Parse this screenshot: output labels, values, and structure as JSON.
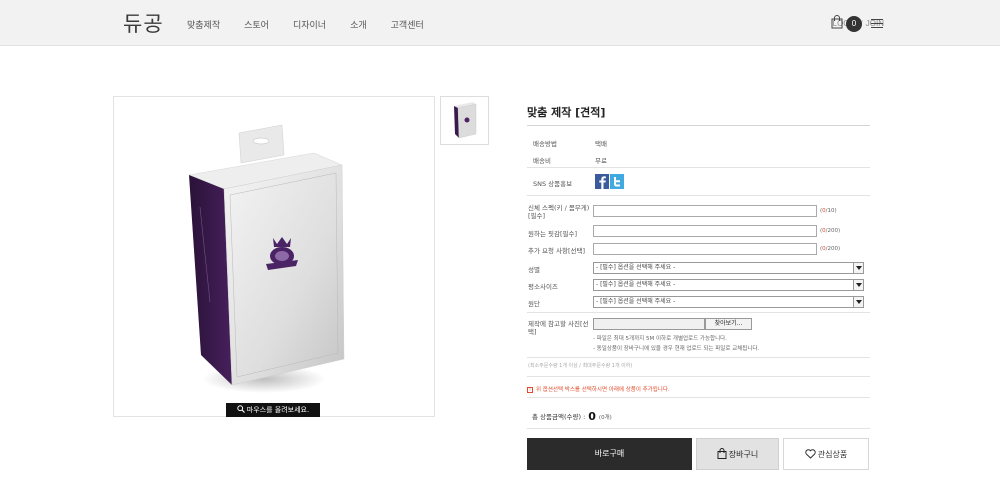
{
  "header": {
    "logo": "듀공",
    "nav": [
      "맞춤제작",
      "스토어",
      "디자이너",
      "소개",
      "고객센터"
    ],
    "login": "LOGIN",
    "join": "JOIN",
    "cart_count": "0"
  },
  "gallery": {
    "zoom_hint": "마우스를 올려보세요."
  },
  "product": {
    "title": "맞춤 제작 [견적]",
    "info": [
      {
        "label": "배송방법",
        "value": "택배"
      },
      {
        "label": "배송비",
        "value": "무료"
      }
    ],
    "sns_label": "SNS 상품홍보",
    "inputs": [
      {
        "label": "신체 스펙(키 / 몸무게)[필수]",
        "count_cur": "0",
        "count_max": "/10)"
      },
      {
        "label": "원하는 핏감[필수]",
        "count_cur": "0",
        "count_max": "/200)"
      },
      {
        "label": "추가 요청 사항[선택]",
        "count_cur": "0",
        "count_max": "/200)"
      }
    ],
    "selects": [
      {
        "label": "성별",
        "value": "- [필수] 옵션을 선택해 주세요 -"
      },
      {
        "label": "평소사이즈",
        "value": "- [필수] 옵션을 선택해 주세요 -"
      },
      {
        "label": "원단",
        "value": "- [필수] 옵션을 선택해 주세요 -"
      }
    ],
    "upload_label": "제작에 참고할 사진[선택]",
    "upload_button": "찾아보기...",
    "upload_notes": [
      "- 파일은 최대 5개까지 5M 이하로 개별업로드 가능합니다.",
      "- 동일상품이 장바구니에 있을 경우 현재 업로드 되는 파일로 교체됩니다."
    ],
    "min_max": "(최소주문수량 1개 이상 / 최대주문수량 1개 이하)",
    "notice_mark": "!",
    "notice": "위 옵션선택 박스를 선택하시면 아래에 상품이 추가됩니다.",
    "total_label": "총 상품금액(수량) :",
    "total_value": "0",
    "total_qty": "(0개)",
    "buy_label": "바로구매",
    "cart_label": "장바구니",
    "wish_label": "관심상품"
  }
}
